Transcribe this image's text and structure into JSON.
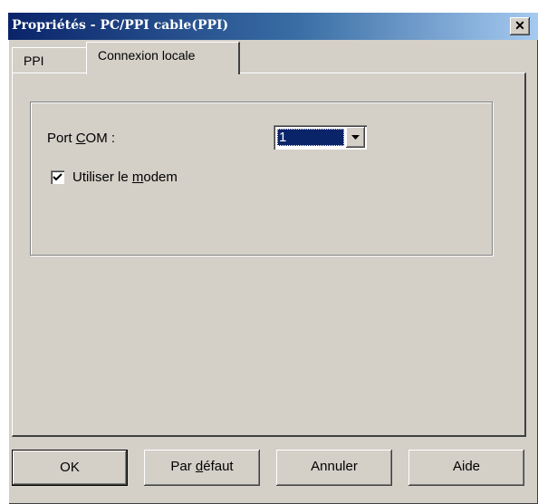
{
  "window": {
    "title": "Propriétés - PC/PPI cable(PPI)",
    "close_label": "✕"
  },
  "tabs": [
    {
      "label": "PPI",
      "selected": false
    },
    {
      "label": "Connexion locale",
      "selected": true
    }
  ],
  "connection": {
    "port_label_pre": "Port ",
    "port_label_mnemonic": "C",
    "port_label_post": "OM :",
    "port_value": "1",
    "modem_label_pre": "Utiliser le ",
    "modem_label_mnemonic": "m",
    "modem_label_post": "odem",
    "modem_checked": true
  },
  "buttons": {
    "ok": "OK",
    "default_pre": "Par ",
    "default_mnemonic": "d",
    "default_post": "éfaut",
    "cancel": "Annuler",
    "help": "Aide"
  },
  "colors": {
    "face": "#d4d0c8",
    "title_start": "#0a246a",
    "title_end": "#a6caf0",
    "selection": "#0a246a"
  }
}
